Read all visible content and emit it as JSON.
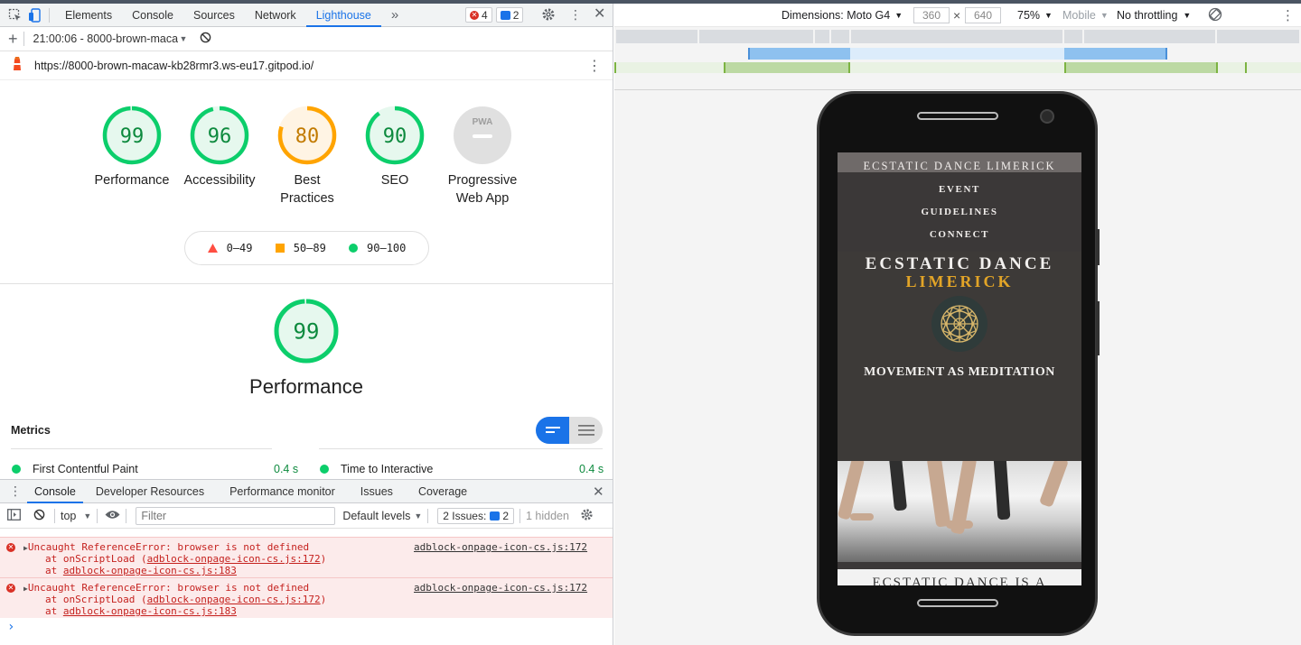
{
  "devtools": {
    "tabs": [
      "Elements",
      "Console",
      "Sources",
      "Network",
      "Lighthouse"
    ],
    "more_tabs": "»",
    "errors_count": "4",
    "messages_count": "2",
    "report_selector": "21:00:06 - 8000-brown-macaв",
    "report_url": "https://8000-brown-macaw-kb28rmr3.ws-eu17.gitpod.io/"
  },
  "lighthouse": {
    "categories": [
      {
        "label_1": "Performance",
        "label_2": "",
        "score": "99",
        "value": 99,
        "color": "#0cce6b",
        "fill": "#e6f8ee",
        "text_color": "#0d8a3e"
      },
      {
        "label_1": "Accessibility",
        "label_2": "",
        "score": "96",
        "value": 96,
        "color": "#0cce6b",
        "fill": "#e6f8ee",
        "text_color": "#0d8a3e"
      },
      {
        "label_1": "Best",
        "label_2": "Practices",
        "score": "80",
        "value": 80,
        "color": "#ffa400",
        "fill": "#fff4e4",
        "text_color": "#c27a00"
      },
      {
        "label_1": "SEO",
        "label_2": "",
        "score": "90",
        "value": 90,
        "color": "#0cce6b",
        "fill": "#e6f8ee",
        "text_color": "#0d8a3e"
      },
      {
        "label_1": "Progressive",
        "label_2": "Web App",
        "score": "PWA",
        "value": 0,
        "color": "#e0e0e0",
        "fill": "#e0e0e0",
        "text_color": "#999999"
      }
    ],
    "legend": {
      "fail": "0–49",
      "average": "50–89",
      "pass": "90–100"
    },
    "perf_score": "99",
    "perf_value": 99,
    "perf_title": "Performance",
    "metrics_heading": "Metrics",
    "metrics": [
      {
        "name": "First Contentful Paint",
        "value": "0.4 s"
      },
      {
        "name": "Time to Interactive",
        "value": "0.4 s"
      }
    ]
  },
  "drawer": {
    "tabs": [
      "Console",
      "Developer Resources",
      "Performance monitor",
      "Issues",
      "Coverage"
    ],
    "context": "top",
    "filter_placeholder": "Filter",
    "levels": "Default levels",
    "issues_label": "2 Issues:",
    "issues_count": "2",
    "hidden": "1 hidden",
    "messages": [
      {
        "line1": "Uncaught ReferenceError: browser is not defined",
        "line2_prefix": "at onScriptLoad (",
        "line2_link": "adblock-onpage-icon-cs.js:172",
        "line2_suffix": ")",
        "line3_prefix": "at ",
        "line3_link": "adblock-onpage-icon-cs.js:183",
        "source": "adblock-onpage-icon-cs.js:172"
      },
      {
        "line1": "Uncaught ReferenceError: browser is not defined",
        "line2_prefix": "at onScriptLoad (",
        "line2_link": "adblock-onpage-icon-cs.js:172",
        "line2_suffix": ")",
        "line3_prefix": "at ",
        "line3_link": "adblock-onpage-icon-cs.js:183",
        "source": "adblock-onpage-icon-cs.js:172"
      }
    ],
    "prompt": "›"
  },
  "device": {
    "dimensions_label": "Dimensions: Moto G4",
    "width": "360",
    "times": "×",
    "height": "640",
    "zoom": "75%",
    "mode": "Mobile",
    "throttling": "No throttling"
  },
  "site": {
    "top_title": "ECSTATIC DANCE LIMERICK",
    "nav": [
      "EVENT",
      "GUIDELINES",
      "CONNECT"
    ],
    "hero_line1": "ECSTATIC DANCE",
    "hero_line2": "LIMERICK",
    "tagline": "MOVEMENT AS MEDITATION",
    "below": "ECSTATIC DANCE IS A"
  },
  "colors": {
    "accent": "#1a73e8",
    "pass": "#0cce6b",
    "average": "#ffa400",
    "fail": "#ff4e42",
    "error_bg": "#fcebeb",
    "site_gold": "#e2a427"
  }
}
